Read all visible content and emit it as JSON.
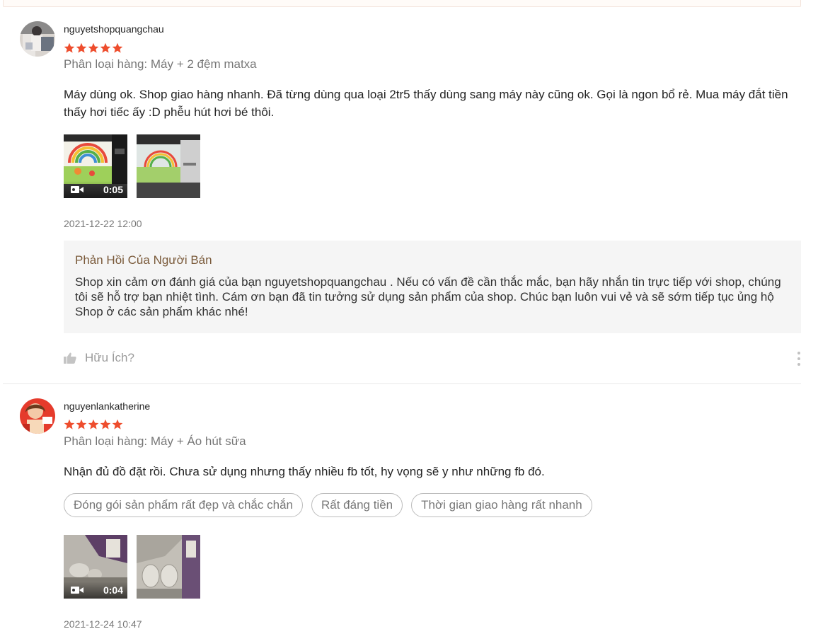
{
  "reviews": [
    {
      "username": "nguyetshopquangchau",
      "rating": 5,
      "variation": "Phân loại hàng: Máy + 2 đệm matxa",
      "comment": "Máy dùng ok. Shop giao hàng nhanh. Đã từng dùng qua loại 2tr5 thấy dùng sang máy này cũng ok. Gọi là ngon bổ rẻ. Mua máy đắt tiền thấy hơi tiếc ấy :D phễu hút hơi bé thôi.",
      "video_duration": "0:05",
      "timestamp": "2021-12-22 12:00",
      "seller_reply": {
        "title": "Phản Hồi Của Người Bán",
        "text": "Shop xin cảm ơn đánh giá của bạn  nguyetshopquangchau . Nếu có vấn đề cần thắc mắc, bạn hãy nhắn tin trực tiếp với shop, chúng tôi sẽ hỗ trợ bạn nhiệt tình. Cám ơn bạn đã tin tưởng sử dụng sản phẩm của shop. Chúc bạn luôn vui vẻ và sẽ sớm tiếp tục ủng hộ Shop ở các sản phẩm khác nhé!"
      },
      "helpful_label": "Hữu Ích?"
    },
    {
      "username": "nguyenlankatherine",
      "rating": 5,
      "variation": "Phân loại hàng: Máy + Áo hút sữa",
      "comment": "Nhận đủ đồ đặt rồi. Chưa sử dụng nhưng thấy nhiều fb tốt, hy vọng sẽ y như những fb đó.",
      "tags": [
        "Đóng gói sản phẩm rất đẹp và chắc chắn",
        "Rất đáng tiền",
        "Thời gian giao hàng rất nhanh"
      ],
      "video_duration": "0:04",
      "timestamp": "2021-12-24 10:47"
    }
  ],
  "colors": {
    "star": "#ee4d2d",
    "reply_bg": "#f5f5f5",
    "reply_title": "#7a5a3a"
  }
}
